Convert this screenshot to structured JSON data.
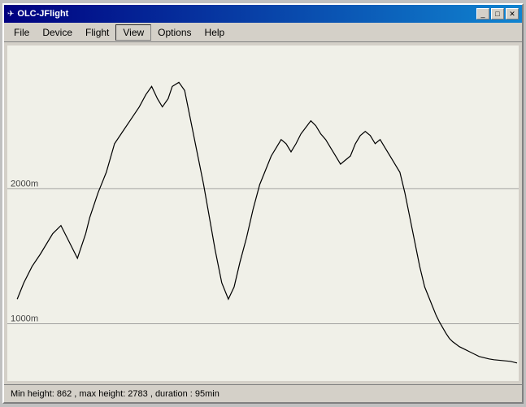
{
  "window": {
    "title": "OLC-JFlight",
    "title_icon": "✈"
  },
  "title_buttons": {
    "minimize": "_",
    "maximize": "□",
    "close": "✕"
  },
  "menu": {
    "items": [
      {
        "label": "File",
        "active": false
      },
      {
        "label": "Device",
        "active": false
      },
      {
        "label": "Flight",
        "active": false
      },
      {
        "label": "View",
        "active": true
      },
      {
        "label": "Options",
        "active": false
      },
      {
        "label": "Help",
        "active": false
      }
    ]
  },
  "chart": {
    "altitude_line_2000_label": "2000m",
    "altitude_line_1000_label": "1000m"
  },
  "status_bar": {
    "text": "Min height: 862 , max height: 2783 , duration : 95min"
  }
}
